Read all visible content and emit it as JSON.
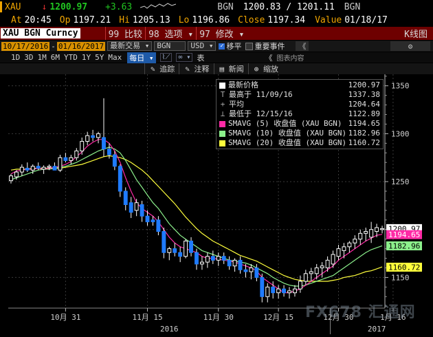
{
  "quote": {
    "ticker": "XAU",
    "arrow": "↓",
    "last": "1200.97",
    "change": "+3.63",
    "source1": "BGN",
    "bid_ask": "1200.83 / 1201.11",
    "source2": "BGN",
    "at_label": "At",
    "at_time": "20:45",
    "op_label": "Op",
    "op_value": "1197.21",
    "hi_label": "Hi",
    "hi_value": "1205.13",
    "lo_label": "Lo",
    "lo_value": "1196.86",
    "close_label": "Close",
    "close_value": "1197.34",
    "value_label": "Value",
    "value_date": "01/18/17"
  },
  "function_bar": {
    "security": "XAU BGN Curncy",
    "compare": "99 比较",
    "options": "98 选项 ▾",
    "modify": "97 修改 ▾",
    "chart_type": "K线图"
  },
  "toolbar": {
    "start_date": "10/17/2016",
    "end_date": "01/16/2017",
    "last_trade": "最新交易",
    "source": "BGN",
    "currency": "USD",
    "move_label": "移平",
    "events_label": "重要事件",
    "collapse": "《",
    "gear": "⚙"
  },
  "period_bar": {
    "periods": [
      "1D",
      "3D",
      "1M",
      "6M",
      "YTD",
      "1Y",
      "5Y",
      "Max"
    ],
    "frequency": "每日 ▾",
    "table_label": "表",
    "collapse": "《",
    "chart_content": "图表内容"
  },
  "draw_bar": {
    "items": [
      "✎ 追踪",
      "✎ 注释",
      "▤ 新闻",
      "⊕ 缩放"
    ]
  },
  "legend": [
    {
      "icon": "square",
      "color": "#ffffff",
      "label": "最新价格",
      "value": "1200.97"
    },
    {
      "icon": "T",
      "label": "最高于 11/09/16",
      "value": "1337.38"
    },
    {
      "icon": "+",
      "label": "平均",
      "value": "1204.64"
    },
    {
      "icon": "⊥",
      "label": "最低于 12/15/16",
      "value": "1122.89"
    },
    {
      "icon": "square",
      "color": "#ff2aa6",
      "label": "SMAVG (5) 收盘值 (XAU BGN)",
      "value": "1194.65"
    },
    {
      "icon": "square",
      "color": "#8cf08c",
      "label": "SMAVG (10) 收盘值 (XAU BGN)",
      "value": "1182.96"
    },
    {
      "icon": "square",
      "color": "#ffff3c",
      "label": "SMAVG (20) 收盘值 (XAU BGN)",
      "value": "1160.72"
    }
  ],
  "chart_data": {
    "type": "candlestick",
    "y_ticks": [
      1150,
      1200,
      1250,
      1300,
      1350
    ],
    "ylim": [
      1118,
      1362
    ],
    "x_labels": [
      {
        "i": 10,
        "text": "10月 31"
      },
      {
        "i": 25,
        "text": "11月 15"
      },
      {
        "i": 38,
        "text": "11月 30"
      },
      {
        "i": 49,
        "text": "12月 15"
      },
      {
        "i": 60,
        "text": "12月 30"
      },
      {
        "i": 70,
        "text": "1月 16"
      }
    ],
    "year_labels": [
      {
        "i": 29,
        "text": "2016"
      },
      {
        "i": 67,
        "text": "2017"
      }
    ],
    "candles": [
      [
        1251,
        1258,
        1248,
        1256
      ],
      [
        1255,
        1262,
        1252,
        1260
      ],
      [
        1260,
        1268,
        1256,
        1265
      ],
      [
        1264,
        1270,
        1260,
        1262
      ],
      [
        1262,
        1268,
        1258,
        1266
      ],
      [
        1266,
        1270,
        1262,
        1264
      ],
      [
        1263,
        1267,
        1258,
        1265
      ],
      [
        1265,
        1268,
        1262,
        1266
      ],
      [
        1266,
        1270,
        1263,
        1262
      ],
      [
        1262,
        1278,
        1260,
        1275
      ],
      [
        1275,
        1280,
        1270,
        1272
      ],
      [
        1272,
        1278,
        1268,
        1275
      ],
      [
        1275,
        1285,
        1272,
        1282
      ],
      [
        1282,
        1296,
        1278,
        1292
      ],
      [
        1292,
        1302,
        1288,
        1298
      ],
      [
        1298,
        1304,
        1292,
        1296
      ],
      [
        1296,
        1302,
        1290,
        1300
      ],
      [
        1296,
        1337,
        1276,
        1284
      ],
      [
        1284,
        1290,
        1274,
        1278
      ],
      [
        1278,
        1282,
        1262,
        1266
      ],
      [
        1266,
        1268,
        1234,
        1240
      ],
      [
        1240,
        1244,
        1220,
        1226
      ],
      [
        1228,
        1234,
        1212,
        1218
      ],
      [
        1220,
        1232,
        1214,
        1228
      ],
      [
        1226,
        1230,
        1208,
        1214
      ],
      [
        1214,
        1220,
        1204,
        1208
      ],
      [
        1210,
        1214,
        1204,
        1208
      ],
      [
        1210,
        1214,
        1194,
        1198
      ],
      [
        1198,
        1202,
        1170,
        1176
      ],
      [
        1176,
        1182,
        1168,
        1180
      ],
      [
        1180,
        1186,
        1172,
        1176
      ],
      [
        1176,
        1182,
        1166,
        1172
      ],
      [
        1172,
        1190,
        1170,
        1188
      ],
      [
        1188,
        1192,
        1172,
        1176
      ],
      [
        1176,
        1180,
        1158,
        1164
      ],
      [
        1164,
        1172,
        1158,
        1166
      ],
      [
        1166,
        1176,
        1160,
        1172
      ],
      [
        1172,
        1178,
        1164,
        1168
      ],
      [
        1168,
        1176,
        1162,
        1172
      ],
      [
        1172,
        1176,
        1164,
        1168
      ],
      [
        1168,
        1172,
        1158,
        1162
      ],
      [
        1162,
        1170,
        1156,
        1168
      ],
      [
        1168,
        1172,
        1154,
        1158
      ],
      [
        1158,
        1164,
        1150,
        1156
      ],
      [
        1156,
        1164,
        1148,
        1160
      ],
      [
        1160,
        1164,
        1146,
        1150
      ],
      [
        1150,
        1154,
        1124,
        1130
      ],
      [
        1130,
        1144,
        1124,
        1140
      ],
      [
        1140,
        1146,
        1128,
        1134
      ],
      [
        1134,
        1142,
        1128,
        1138
      ],
      [
        1138,
        1142,
        1130,
        1134
      ],
      [
        1134,
        1140,
        1128,
        1136
      ],
      [
        1134,
        1142,
        1130,
        1138
      ],
      [
        1138,
        1152,
        1134,
        1146
      ],
      [
        1146,
        1158,
        1142,
        1154
      ],
      [
        1154,
        1160,
        1146,
        1156
      ],
      [
        1154,
        1164,
        1148,
        1160
      ],
      [
        1160,
        1166,
        1150,
        1162
      ],
      [
        1160,
        1172,
        1156,
        1168
      ],
      [
        1164,
        1178,
        1160,
        1174
      ],
      [
        1172,
        1184,
        1168,
        1180
      ],
      [
        1178,
        1186,
        1170,
        1182
      ],
      [
        1182,
        1188,
        1176,
        1186
      ],
      [
        1186,
        1194,
        1180,
        1190
      ],
      [
        1190,
        1200,
        1184,
        1196
      ],
      [
        1196,
        1202,
        1188,
        1198
      ],
      [
        1192,
        1208,
        1186,
        1200
      ],
      [
        1198,
        1206,
        1192,
        1202
      ],
      [
        1200,
        1204,
        1196,
        1201
      ]
    ],
    "sma5": [
      1258,
      1261,
      1262,
      1263,
      1263,
      1264,
      1263,
      1264,
      1265,
      1266,
      1268,
      1271,
      1276,
      1281,
      1287,
      1291,
      1294,
      1294,
      1290,
      1282,
      1270,
      1254,
      1240,
      1228,
      1222,
      1218,
      1214,
      1208,
      1200,
      1192,
      1186,
      1182,
      1180,
      1178,
      1176,
      1172,
      1170,
      1170,
      1169,
      1168,
      1167,
      1166,
      1164,
      1162,
      1160,
      1157,
      1150,
      1146,
      1142,
      1138,
      1134,
      1134,
      1136,
      1138,
      1142,
      1146,
      1150,
      1154,
      1158,
      1162,
      1168,
      1172,
      1176,
      1180,
      1184,
      1188,
      1191,
      1194,
      1195
    ],
    "sma10": [
      1252,
      1254,
      1256,
      1258,
      1260,
      1262,
      1263,
      1263,
      1264,
      1265,
      1266,
      1268,
      1270,
      1273,
      1276,
      1279,
      1282,
      1284,
      1286,
      1284,
      1280,
      1272,
      1262,
      1252,
      1244,
      1236,
      1228,
      1222,
      1214,
      1206,
      1200,
      1194,
      1190,
      1186,
      1182,
      1178,
      1176,
      1174,
      1172,
      1170,
      1168,
      1167,
      1166,
      1165,
      1163,
      1160,
      1157,
      1154,
      1150,
      1147,
      1144,
      1142,
      1141,
      1141,
      1142,
      1144,
      1146,
      1148,
      1150,
      1152,
      1156,
      1160,
      1164,
      1168,
      1172,
      1176,
      1179,
      1181,
      1183
    ],
    "sma20": [
      1262,
      1263,
      1263,
      1263,
      1264,
      1264,
      1264,
      1264,
      1264,
      1264,
      1265,
      1266,
      1267,
      1268,
      1270,
      1272,
      1274,
      1276,
      1277,
      1276,
      1275,
      1273,
      1270,
      1266,
      1262,
      1257,
      1251,
      1245,
      1239,
      1233,
      1227,
      1220,
      1213,
      1207,
      1201,
      1196,
      1192,
      1188,
      1185,
      1182,
      1179,
      1176,
      1173,
      1171,
      1169,
      1167,
      1164,
      1161,
      1158,
      1155,
      1152,
      1150,
      1148,
      1147,
      1146,
      1146,
      1146,
      1146,
      1146,
      1147,
      1148,
      1150,
      1151,
      1152,
      1154,
      1156,
      1157,
      1159,
      1161
    ],
    "colors": {
      "up": "#ffffff",
      "down": "#1f7bff",
      "sma5": "#ff2aa6",
      "sma10": "#8cf08c",
      "sma20": "#ffff3c"
    },
    "price_tags": [
      {
        "value": 1200.97,
        "text": "1200.97",
        "bg": "#ffffff",
        "fg": "#000000"
      },
      {
        "value": 1194.65,
        "text": "1194.65",
        "bg": "#ff2aa6",
        "fg": "#ffffff"
      },
      {
        "value": 1182.96,
        "text": "1182.96",
        "bg": "#8cf08c",
        "fg": "#000000"
      },
      {
        "value": 1160.72,
        "text": "1160.72",
        "bg": "#ffff3c",
        "fg": "#000000"
      }
    ]
  },
  "watermark": "FX678 汇通网"
}
